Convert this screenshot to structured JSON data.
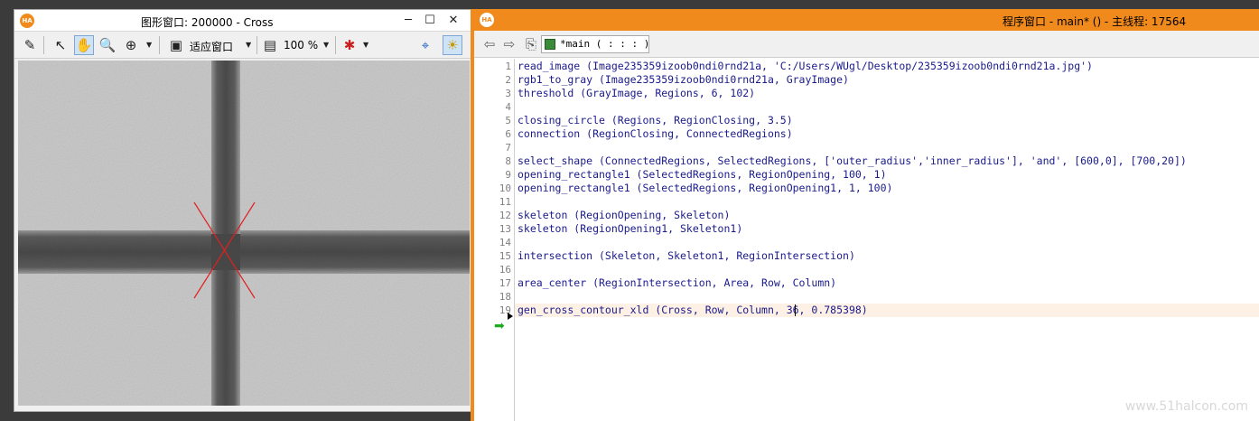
{
  "graphics_window": {
    "logo": "HA",
    "title": "图形窗口: 200000 - Cross",
    "zoom_fit_label": "适应窗口",
    "zoom_percent": "100 %",
    "icons": [
      "pen-icon",
      "pointer-icon",
      "hand-pan-icon",
      "magnifier-icon",
      "zoom-in-icon",
      "fit-window-icon",
      "image-zoom-icon",
      "color-brush-icon",
      "crosshair-icon",
      "bulb-icon"
    ],
    "minimize": "─",
    "maximize": "☐",
    "close": "✕"
  },
  "program_window": {
    "logo": "HA",
    "title": "程序窗口 - main* () - 主线程: 17564",
    "procedure": "*main ( : : : )",
    "lines": [
      {
        "n": "1",
        "code": "read_image (Image235359izoob0ndi0rnd21a, 'C:/Users/WUgl/Desktop/235359izoob0ndi0rnd21a.jpg')"
      },
      {
        "n": "2",
        "code": "rgb1_to_gray (Image235359izoob0ndi0rnd21a, GrayImage)"
      },
      {
        "n": "3",
        "code": "threshold (GrayImage, Regions, 6, 102)"
      },
      {
        "n": "4",
        "code": ""
      },
      {
        "n": "5",
        "code": "closing_circle (Regions, RegionClosing, 3.5)"
      },
      {
        "n": "6",
        "code": "connection (RegionClosing, ConnectedRegions)"
      },
      {
        "n": "7",
        "code": ""
      },
      {
        "n": "8",
        "code": "select_shape (ConnectedRegions, SelectedRegions, ['outer_radius','inner_radius'], 'and', [600,0], [700,20])"
      },
      {
        "n": "9",
        "code": "opening_rectangle1 (SelectedRegions, RegionOpening, 100, 1)"
      },
      {
        "n": "10",
        "code": "opening_rectangle1 (SelectedRegions, RegionOpening1, 1, 100)"
      },
      {
        "n": "11",
        "code": ""
      },
      {
        "n": "12",
        "code": "skeleton (RegionOpening, Skeleton)"
      },
      {
        "n": "13",
        "code": "skeleton (RegionOpening1, Skeleton1)"
      },
      {
        "n": "14",
        "code": ""
      },
      {
        "n": "15",
        "code": "intersection (Skeleton, Skeleton1, RegionIntersection)"
      },
      {
        "n": "16",
        "code": ""
      },
      {
        "n": "17",
        "code": "area_center (RegionIntersection, Area, Row, Column)"
      },
      {
        "n": "18",
        "code": ""
      },
      {
        "n": "19",
        "code": "gen_cross_contour_xld (Cross, Row, Column, 36, 0.785398)"
      }
    ]
  },
  "watermark": "www.51halcon.com",
  "colors": {
    "accent": "#f08a1d",
    "code": "#1a1a8c",
    "cross": "#e02020"
  }
}
